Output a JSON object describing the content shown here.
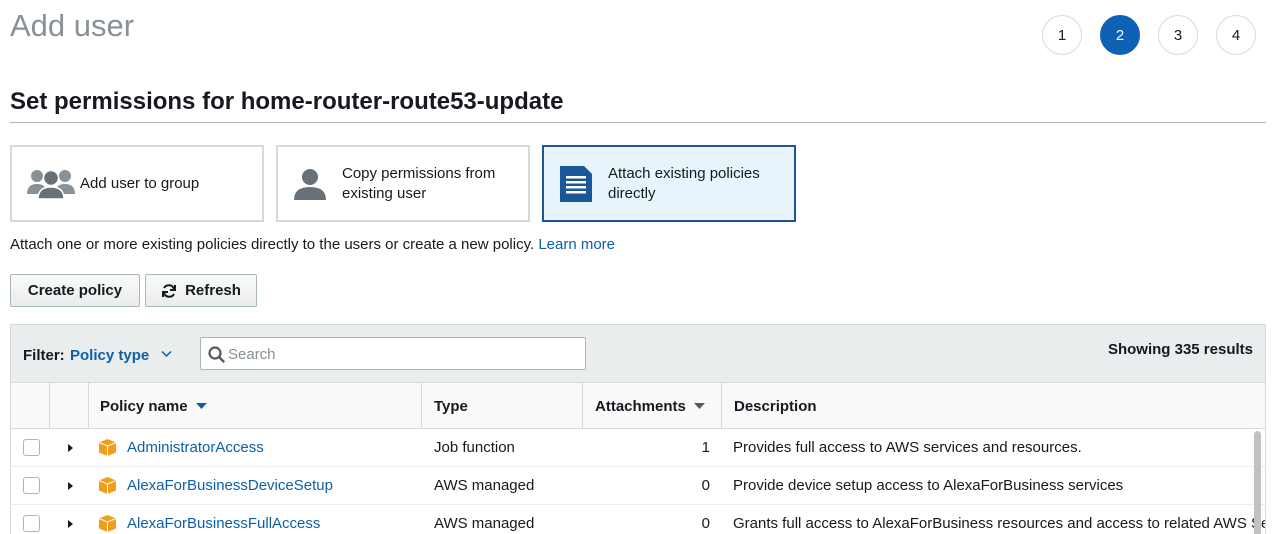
{
  "page": {
    "title": "Add user"
  },
  "steps": [
    "1",
    "2",
    "3",
    "4"
  ],
  "active_step": "2",
  "section": {
    "title": "Set permissions for home-router-route53-update"
  },
  "options": {
    "group": "Add user to group",
    "copy_line1": "Copy permissions from",
    "copy_line2": "existing user",
    "attach_line1": "Attach existing policies",
    "attach_line2": "directly"
  },
  "help": {
    "text": "Attach one or more existing policies directly to the users or create a new policy. ",
    "link": "Learn more"
  },
  "buttons": {
    "create_policy": "Create policy",
    "refresh": "Refresh"
  },
  "filter": {
    "label": "Filter:",
    "value": "Policy type",
    "search_placeholder": "Search",
    "results": "Showing 335 results"
  },
  "table": {
    "headers": {
      "name": "Policy name",
      "type": "Type",
      "attachments": "Attachments",
      "description": "Description"
    },
    "rows": [
      {
        "name": "AdministratorAccess",
        "type": "Job function",
        "attachments": "1",
        "description": "Provides full access to AWS services and resources."
      },
      {
        "name": "AlexaForBusinessDeviceSetup",
        "type": "AWS managed",
        "attachments": "0",
        "description": "Provide device setup access to AlexaForBusiness services"
      },
      {
        "name": "AlexaForBusinessFullAccess",
        "type": "AWS managed",
        "attachments": "0",
        "description": "Grants full access to AlexaForBusiness resources and access to related AWS Services"
      }
    ]
  },
  "colors": {
    "accent": "#0e61b5",
    "link": "#0d5fa8",
    "policy_icon": "#f19e1d"
  },
  "icons": {
    "group": "users-icon",
    "copy": "user-icon",
    "attach": "document-icon",
    "refresh": "refresh-icon",
    "search": "search-icon",
    "policy": "cube-icon"
  }
}
